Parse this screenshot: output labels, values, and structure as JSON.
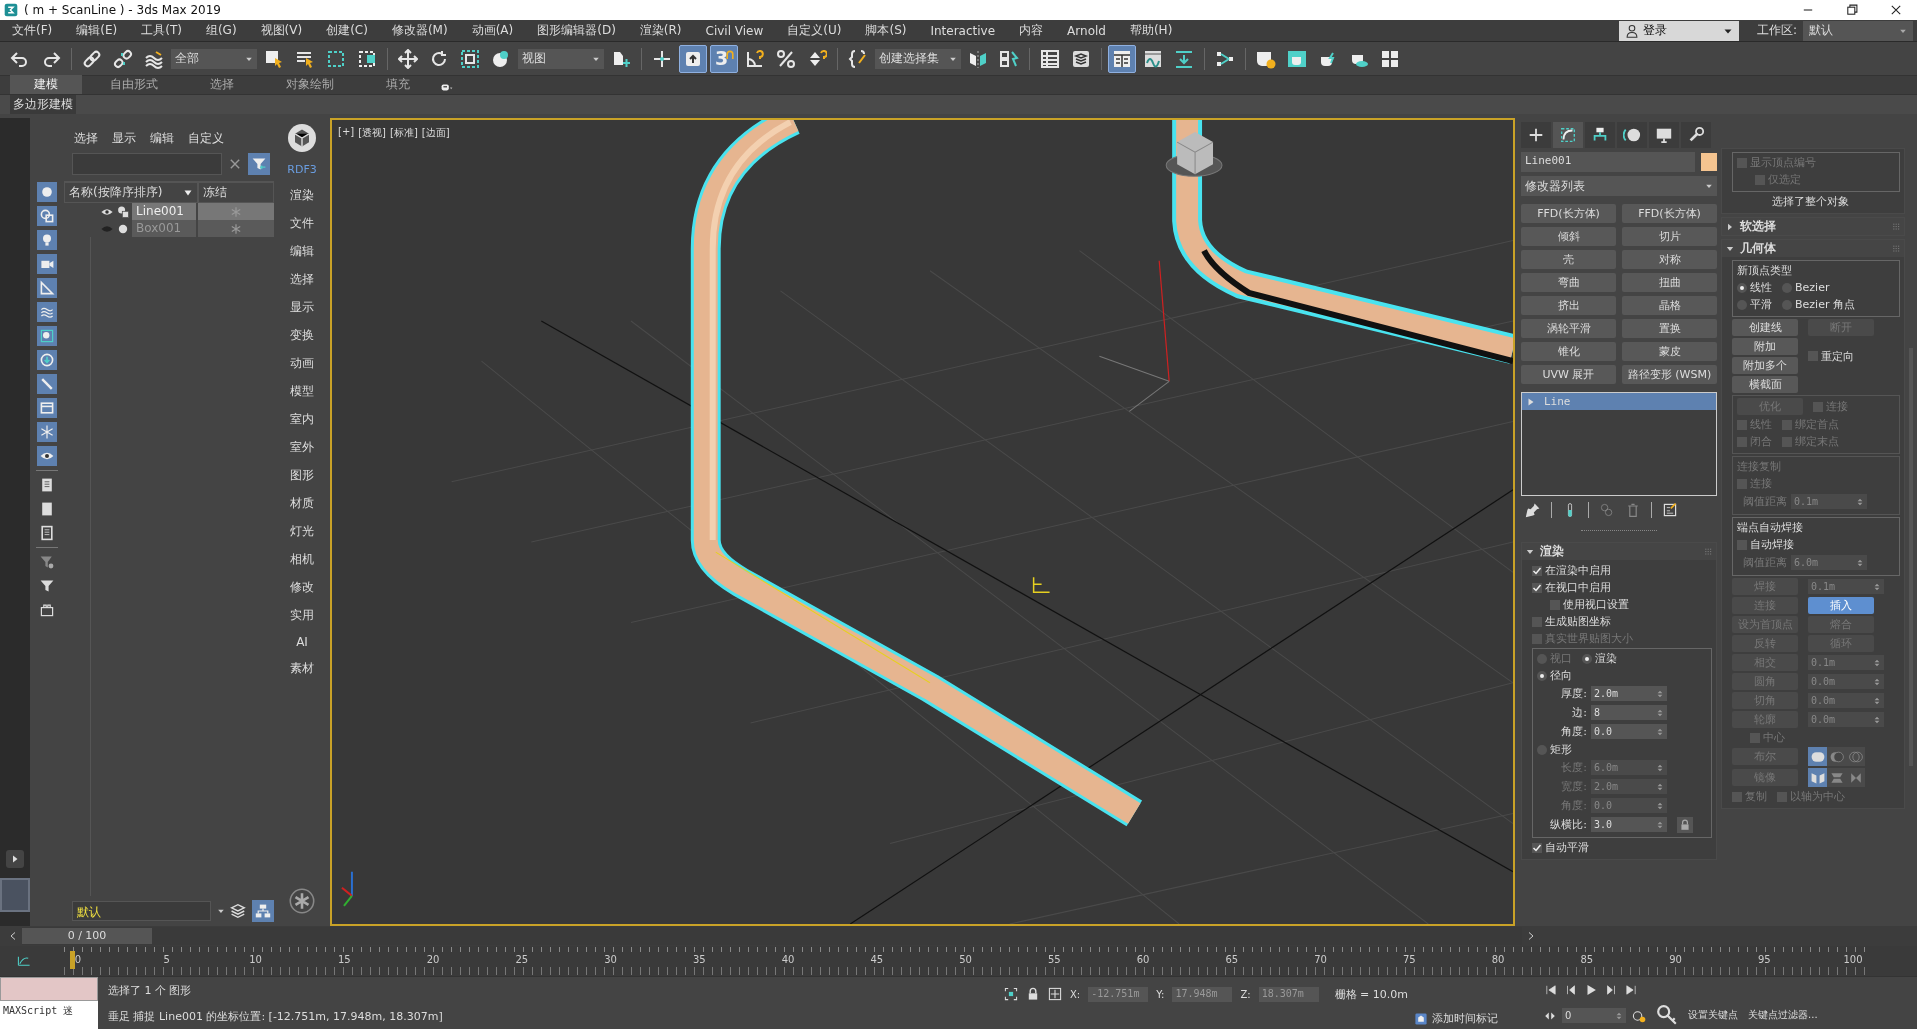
{
  "window": {
    "title": "( m + ScanLine ) - 3ds Max 2019"
  },
  "menu": [
    {
      "label": "文件(F)"
    },
    {
      "label": "编辑(E)"
    },
    {
      "label": "工具(T)"
    },
    {
      "label": "组(G)"
    },
    {
      "label": "视图(V)"
    },
    {
      "label": "创建(C)"
    },
    {
      "label": "修改器(M)"
    },
    {
      "label": "动画(A)"
    },
    {
      "label": "图形编辑器(D)"
    },
    {
      "label": "渲染(R)"
    },
    {
      "label": "Civil View"
    },
    {
      "label": "自定义(U)"
    },
    {
      "label": "脚本(S)"
    },
    {
      "label": "Interactive"
    },
    {
      "label": "内容"
    },
    {
      "label": "Arnold"
    },
    {
      "label": "帮助(H)"
    }
  ],
  "account": {
    "label": "登录"
  },
  "workspace": {
    "label": "工作区:",
    "value": "默认"
  },
  "main_toolbar": [
    {
      "kind": "button",
      "selected": false
    },
    {
      "kind": "button",
      "selected": false
    },
    {
      "kind": "separator"
    },
    {
      "kind": "button",
      "selected": false
    },
    {
      "kind": "button",
      "selected": false
    },
    {
      "kind": "button",
      "selected": false
    },
    {
      "kind": "dropdown",
      "value": "全部"
    },
    {
      "kind": "button",
      "selected": false
    },
    {
      "kind": "button",
      "selected": false
    },
    {
      "kind": "button",
      "selected": false
    },
    {
      "kind": "button",
      "selected": false
    },
    {
      "kind": "separator"
    },
    {
      "kind": "button",
      "selected": false
    },
    {
      "kind": "button",
      "selected": false
    },
    {
      "kind": "button",
      "selected": false
    },
    {
      "kind": "button",
      "selected": false
    },
    {
      "kind": "dropdown",
      "value": "视图"
    },
    {
      "kind": "button",
      "selected": false
    },
    {
      "kind": "separator"
    },
    {
      "kind": "button",
      "selected": false
    },
    {
      "kind": "button",
      "selected": true
    },
    {
      "kind": "button",
      "selected": true,
      "label": "3"
    },
    {
      "kind": "button",
      "selected": false
    },
    {
      "kind": "button",
      "selected": false
    },
    {
      "kind": "button",
      "selected": false
    },
    {
      "kind": "separator"
    },
    {
      "kind": "button",
      "selected": false
    },
    {
      "kind": "dropdown",
      "value": "创建选择集"
    },
    {
      "kind": "button",
      "selected": false
    },
    {
      "kind": "button",
      "selected": false
    },
    {
      "kind": "separator"
    },
    {
      "kind": "button",
      "selected": false
    },
    {
      "kind": "button",
      "selected": false
    },
    {
      "kind": "separator"
    },
    {
      "kind": "button",
      "selected": true
    },
    {
      "kind": "button",
      "selected": false
    },
    {
      "kind": "button",
      "selected": false
    },
    {
      "kind": "separator"
    },
    {
      "kind": "button",
      "selected": false
    },
    {
      "kind": "separator"
    },
    {
      "kind": "button",
      "selected": false
    },
    {
      "kind": "button",
      "selected": false
    },
    {
      "kind": "button",
      "selected": false
    },
    {
      "kind": "button",
      "selected": false
    },
    {
      "kind": "button",
      "selected": false
    }
  ],
  "ribbon": {
    "tabs": [
      {
        "label": "建模",
        "selected": true
      },
      {
        "label": "自由形式",
        "selected": false
      },
      {
        "label": "选择",
        "selected": false
      },
      {
        "label": "对象绘制",
        "selected": false
      },
      {
        "label": "填充",
        "selected": false
      }
    ],
    "panel_tab": "多边形建模"
  },
  "scene_explorer": {
    "menu": [
      "选择",
      "显示",
      "编辑",
      "自定义"
    ],
    "filters": [
      {
        "on": true
      },
      {
        "on": true
      },
      {
        "on": true
      },
      {
        "on": true
      },
      {
        "on": true
      },
      {
        "on": true
      },
      {
        "on": true
      },
      {
        "on": true
      },
      {
        "on": true
      },
      {
        "on": true
      },
      {
        "on": true
      },
      {
        "on": true
      },
      {
        "on": false
      },
      {
        "on": false
      },
      {
        "on": false
      },
      {
        "on": false
      },
      {
        "on": false
      },
      {
        "on": false
      }
    ],
    "columns": [
      "名称(按降序排序)",
      "冻结"
    ],
    "rows": [
      {
        "name": "Line001",
        "selected": true,
        "hidden": false
      },
      {
        "name": "Box001",
        "selected": false,
        "hidden": true
      }
    ],
    "layer": "默认"
  },
  "side_menu": [
    {
      "label": "RDF3",
      "kind": "brand"
    },
    {
      "label": "渲染",
      "kind": "item"
    },
    {
      "label": "文件",
      "kind": "item"
    },
    {
      "label": "编辑",
      "kind": "item"
    },
    {
      "label": "选择",
      "kind": "item"
    },
    {
      "label": "显示",
      "kind": "item"
    },
    {
      "label": "变换",
      "kind": "item"
    },
    {
      "label": "动画",
      "kind": "item"
    },
    {
      "label": "模型",
      "kind": "item"
    },
    {
      "label": "室内",
      "kind": "item"
    },
    {
      "label": "室外",
      "kind": "item"
    },
    {
      "label": "图形",
      "kind": "item"
    },
    {
      "label": "材质",
      "kind": "item"
    },
    {
      "label": "灯光",
      "kind": "item"
    },
    {
      "label": "相机",
      "kind": "item"
    },
    {
      "label": "修改",
      "kind": "item"
    },
    {
      "label": "实用",
      "kind": "item"
    },
    {
      "label": "AI",
      "kind": "item"
    },
    {
      "label": "素材",
      "kind": "item"
    }
  ],
  "viewport": {
    "labels": [
      "[+]",
      "[透视]",
      "[标准]",
      "[边面]"
    ]
  },
  "command_panel": {
    "tabs": [
      {
        "selected": false
      },
      {
        "selected": true
      },
      {
        "selected": false
      },
      {
        "selected": false
      },
      {
        "selected": false
      },
      {
        "selected": false
      }
    ],
    "object_name": "Line001",
    "modifier_list": "修改器列表",
    "modifier_buttons": [
      "FFD(长方体)",
      "FFD(长方体)",
      "倾斜",
      "切片",
      "壳",
      "对称",
      "弯曲",
      "扭曲",
      "挤出",
      "晶格",
      "涡轮平滑",
      "置换",
      "锥化",
      "蒙皮",
      "UVW 展开",
      "路径变形 (WSM)"
    ],
    "stack": [
      {
        "name": "Line",
        "selected": true
      }
    ],
    "left_rollouts": [
      {
        "title": "渲染",
        "expanded": true,
        "items": [
          {
            "kind": "checkbox",
            "label": "在渲染中启用",
            "checked": true,
            "disabled": false
          },
          {
            "kind": "checkbox",
            "label": "在视口中启用",
            "checked": true,
            "disabled": false
          },
          {
            "kind": "indent",
            "items": [
              {
                "kind": "checkbox",
                "label": "使用视口设置",
                "checked": false,
                "disabled": false
              }
            ]
          },
          {
            "kind": "checkbox",
            "label": "生成贴图坐标",
            "checked": false,
            "disabled": false
          },
          {
            "kind": "checkbox",
            "label": "真实世界贴图大小",
            "checked": false,
            "disabled": true
          },
          {
            "kind": "group",
            "items": [
              {
                "kind": "row",
                "items": [
                  {
                    "kind": "radio",
                    "label": "视口",
                    "selected": false,
                    "disabled": true
                  },
                  {
                    "kind": "radio",
                    "label": "渲染",
                    "selected": true,
                    "disabled": false
                  }
                ]
              },
              {
                "kind": "radio",
                "label": "径向",
                "selected": true,
                "disabled": false
              },
              {
                "kind": "spinner",
                "label": "厚度:",
                "value": "2.0m",
                "disabled": false
              },
              {
                "kind": "spinner",
                "label": "边:",
                "value": "8",
                "disabled": false
              },
              {
                "kind": "spinner",
                "label": "角度:",
                "value": "0.0",
                "disabled": false
              },
              {
                "kind": "radio",
                "label": "矩形",
                "selected": false,
                "disabled": false
              },
              {
                "kind": "spinner",
                "label": "长度:",
                "value": "6.0m",
                "disabled": true
              },
              {
                "kind": "spinner",
                "label": "宽度:",
                "value": "2.0m",
                "disabled": true
              },
              {
                "kind": "spinner",
                "label": "角度:",
                "value": "0.0",
                "disabled": true
              },
              {
                "kind": "row",
                "items": [
                  {
                    "kind": "spinner",
                    "label": "纵横比:",
                    "value": "3.0",
                    "disabled": false
                  },
                  {
                    "kind": "lock"
                  }
                ]
              }
            ]
          },
          {
            "kind": "checkbox",
            "label": "自动平滑",
            "checked": true,
            "disabled": false
          }
        ]
      }
    ],
    "right_rollouts": [
      {
        "items": [
          {
            "kind": "group",
            "items": [
              {
                "kind": "checkbox",
                "label": "显示顶点编号",
                "checked": false,
                "disabled": true
              },
              {
                "kind": "indent",
                "items": [
                  {
                    "kind": "checkbox",
                    "label": "仅选定",
                    "checked": false,
                    "disabled": true
                  }
                ]
              }
            ]
          },
          {
            "kind": "text",
            "label": "选择了整个对象"
          }
        ]
      },
      {
        "title": "软选择",
        "expanded": false
      },
      {
        "title": "几何体",
        "expanded": true,
        "items": [
          {
            "kind": "group",
            "title": "新顶点类型",
            "disabled": false,
            "items": [
              {
                "kind": "row",
                "items": [
                  {
                    "kind": "radio",
                    "label": "线性",
                    "selected": true,
                    "disabled": false
                  },
                  {
                    "kind": "radio",
                    "label": "Bezier",
                    "selected": false,
                    "disabled": false
                  }
                ]
              },
              {
                "kind": "row",
                "items": [
                  {
                    "kind": "radio",
                    "label": "平滑",
                    "selected": false,
                    "disabled": false
                  },
                  {
                    "kind": "radio",
                    "label": "Bezier 角点",
                    "selected": false,
                    "disabled": false
                  }
                ]
              }
            ]
          },
          {
            "kind": "row",
            "items": [
              {
                "kind": "button",
                "label": "创建线",
                "disabled": false,
                "selected": false
              },
              {
                "kind": "button",
                "label": "断开",
                "disabled": true,
                "selected": false
              }
            ]
          },
          {
            "kind": "row",
            "items": [
              {
                "kind": "column",
                "items": [
                  {
                    "kind": "button",
                    "label": "附加",
                    "disabled": false,
                    "selected": false
                  },
                  {
                    "kind": "button",
                    "label": "附加多个",
                    "disabled": false,
                    "selected": false
                  }
                ]
              },
              {
                "kind": "checkbox",
                "label": "重定向",
                "checked": false,
                "disabled": false
              }
            ]
          },
          {
            "kind": "row",
            "items": [
              {
                "kind": "button",
                "label": "横截面",
                "disabled": false,
                "selected": false
              }
            ]
          },
          {
            "kind": "group",
            "disabled": true,
            "items": [
              {
                "kind": "row",
                "items": [
                  {
                    "kind": "button",
                    "label": "优化",
                    "disabled": true,
                    "selected": false
                  },
                  {
                    "kind": "checkbox",
                    "label": "连接",
                    "checked": false,
                    "disabled": true
                  }
                ]
              },
              {
                "kind": "row",
                "items": [
                  {
                    "kind": "checkbox",
                    "label": "线性",
                    "checked": false,
                    "disabled": true
                  },
                  {
                    "kind": "checkbox",
                    "label": "绑定首点",
                    "checked": false,
                    "disabled": true
                  }
                ]
              },
              {
                "kind": "row",
                "items": [
                  {
                    "kind": "checkbox",
                    "label": "闭合",
                    "checked": false,
                    "disabled": true
                  },
                  {
                    "kind": "checkbox",
                    "label": "绑定末点",
                    "checked": false,
                    "disabled": true
                  }
                ]
              }
            ]
          },
          {
            "kind": "group",
            "title": "连接复制",
            "disabled": true,
            "items": [
              {
                "kind": "checkbox",
                "label": "连接",
                "checked": false,
                "disabled": true
              },
              {
                "kind": "spinner",
                "label": "阈值距离",
                "value": "0.1m",
                "disabled": true
              }
            ]
          },
          {
            "kind": "group",
            "title": "端点自动焊接",
            "disabled": false,
            "items": [
              {
                "kind": "checkbox",
                "label": "自动焊接",
                "checked": false,
                "disabled": false
              },
              {
                "kind": "spinner",
                "label": "阈值距离",
                "value": "6.0m",
                "disabled": true
              }
            ]
          },
          {
            "kind": "row",
            "items": [
              {
                "kind": "button",
                "label": "焊接",
                "disabled": true,
                "selected": false
              },
              {
                "kind": "spinner",
                "value": "0.1m",
                "disabled": true
              }
            ]
          },
          {
            "kind": "row",
            "items": [
              {
                "kind": "button",
                "label": "连接",
                "disabled": true,
                "selected": false
              },
              {
                "kind": "button",
                "label": "插入",
                "disabled": false,
                "selected": true
              }
            ]
          },
          {
            "kind": "row",
            "items": [
              {
                "kind": "button",
                "label": "设为首顶点",
                "disabled": true,
                "selected": false
              },
              {
                "kind": "button",
                "label": "熔合",
                "disabled": true,
                "selected": false
              }
            ]
          },
          {
            "kind": "row",
            "items": [
              {
                "kind": "button",
                "label": "反转",
                "disabled": true,
                "selected": false
              },
              {
                "kind": "button",
                "label": "循环",
                "disabled": true,
                "selected": false
              }
            ]
          },
          {
            "kind": "row",
            "items": [
              {
                "kind": "button",
                "label": "相交",
                "disabled": true,
                "selected": false
              },
              {
                "kind": "spinner",
                "value": "0.1m",
                "disabled": true
              }
            ]
          },
          {
            "kind": "row",
            "items": [
              {
                "kind": "button",
                "label": "圆角",
                "disabled": true,
                "selected": false
              },
              {
                "kind": "spinner",
                "value": "0.0m",
                "disabled": true
              }
            ]
          },
          {
            "kind": "row",
            "items": [
              {
                "kind": "button",
                "label": "切角",
                "disabled": true,
                "selected": false
              },
              {
                "kind": "spinner",
                "value": "0.0m",
                "disabled": true
              }
            ]
          },
          {
            "kind": "row",
            "items": [
              {
                "kind": "button",
                "label": "轮廓",
                "disabled": true,
                "selected": false
              },
              {
                "kind": "spinner",
                "value": "0.0m",
                "disabled": true
              }
            ]
          },
          {
            "kind": "indent",
            "items": [
              {
                "kind": "checkbox",
                "label": "中心",
                "checked": false,
                "disabled": true
              }
            ]
          },
          {
            "kind": "row",
            "items": [
              {
                "kind": "button",
                "label": "布尔",
                "disabled": true,
                "selected": false
              },
              {
                "kind": "boolean_icons",
                "buttons": [
                  {
                    "selected": true
                  },
                  {
                    "selected": false
                  },
                  {
                    "selected": false
                  }
                ]
              }
            ]
          },
          {
            "kind": "row",
            "items": [
              {
                "kind": "button",
                "label": "镜像",
                "disabled": true,
                "selected": false
              },
              {
                "kind": "mirror_icons",
                "buttons": [
                  {
                    "selected": true
                  },
                  {
                    "selected": false
                  },
                  {
                    "selected": false
                  }
                ]
              }
            ]
          },
          {
            "kind": "row",
            "items": [
              {
                "kind": "checkbox",
                "label": "复制",
                "checked": false,
                "disabled": true
              },
              {
                "kind": "checkbox",
                "label": "以轴为中心",
                "checked": false,
                "disabled": true
              }
            ]
          }
        ]
      }
    ]
  },
  "timeline": {
    "position": "0 / 100",
    "level": 0,
    "ticks": [
      "0",
      "5",
      "10",
      "15",
      "20",
      "25",
      "30",
      "35",
      "40",
      "45",
      "50",
      "55",
      "60",
      "65",
      "70",
      "75",
      "80",
      "85",
      "90",
      "95",
      "100"
    ]
  },
  "status_bar": {
    "maxscript": "MAXScript 迷",
    "selection": "选择了 1 个 图形",
    "prompt": "垂足 捕捉 Line001 的坐标位置: [-12.751m, 17.948m, 18.307m]",
    "coords": [
      {
        "label": "X:",
        "value": "-12.751m"
      },
      {
        "label": "Y:",
        "value": "17.948m"
      },
      {
        "label": "Z:",
        "value": "18.307m"
      }
    ],
    "grid": "栅格 = 10.0m",
    "add_time_tag": "添加时间标记",
    "frame": "0",
    "set_key": "设置关键点",
    "key_filters": "关键点过滤器..."
  }
}
